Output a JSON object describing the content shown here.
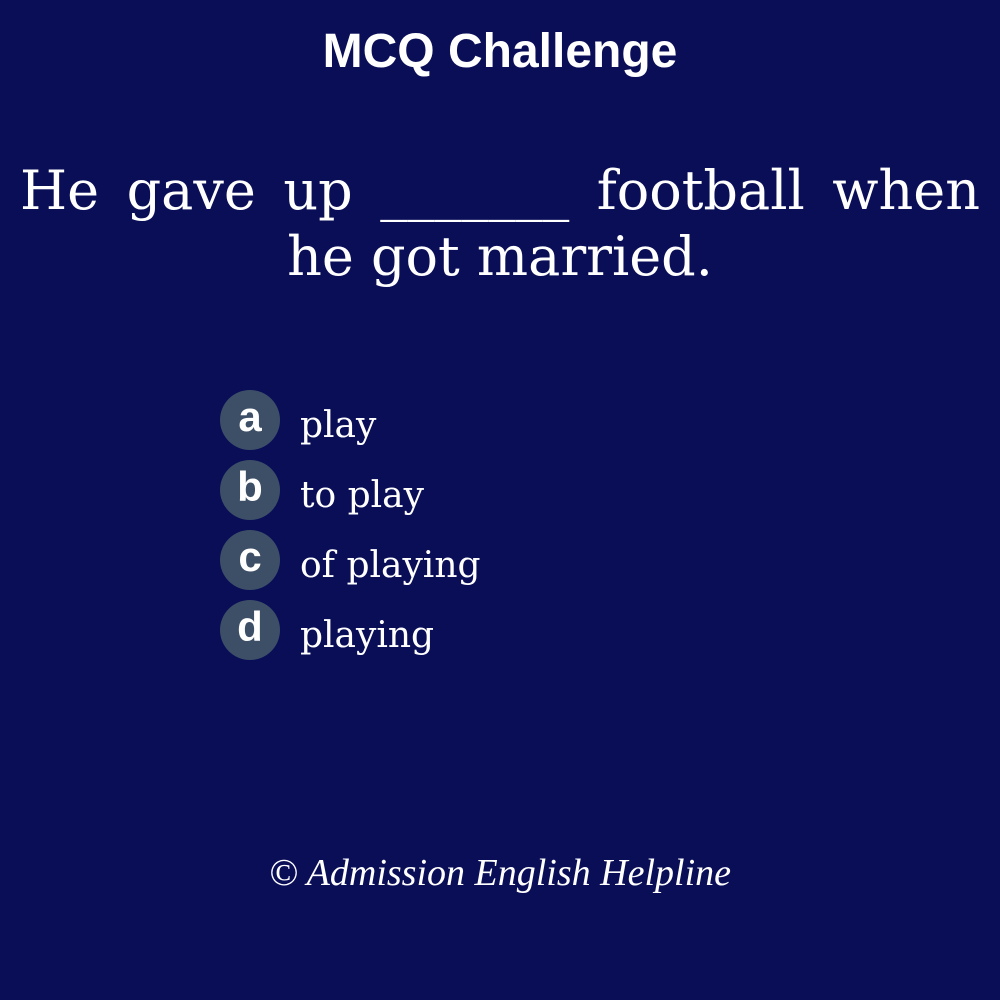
{
  "header": {
    "title": "MCQ Challenge"
  },
  "question": {
    "text": "He gave up _______ football when he got married."
  },
  "options": [
    {
      "letter": "a",
      "text": "play"
    },
    {
      "letter": "b",
      "text": "to play"
    },
    {
      "letter": "c",
      "text": "of playing"
    },
    {
      "letter": "d",
      "text": "playing"
    }
  ],
  "footer": {
    "copyright": "© Admission English Helpline"
  },
  "colors": {
    "background": "#0a0e57",
    "badge": "#3d4f67",
    "text": "#ffffff"
  }
}
